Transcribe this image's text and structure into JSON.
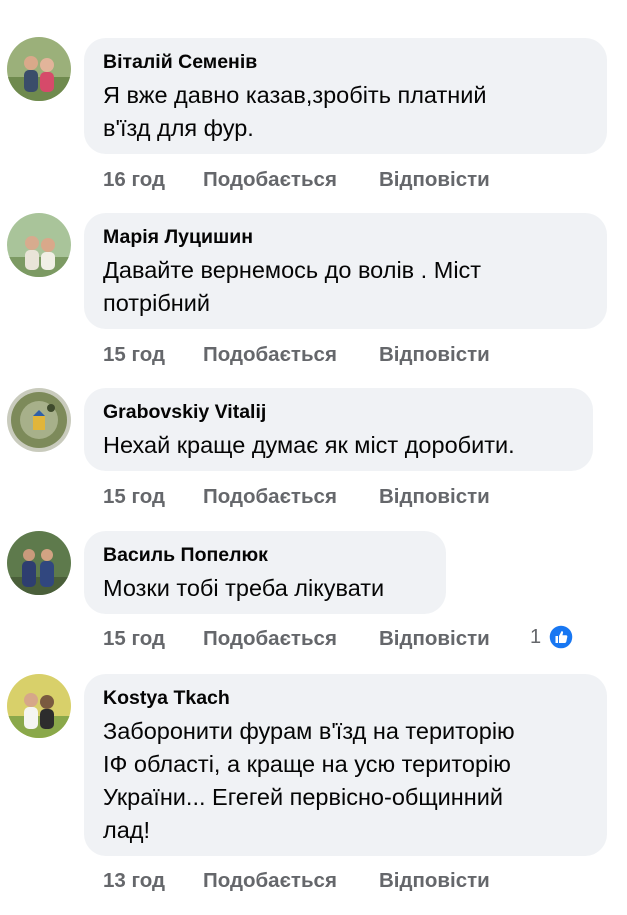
{
  "header_fragment": "",
  "actions": {
    "like": "Подобається",
    "reply": "Відповісти"
  },
  "comments": [
    {
      "author": "Віталій Семенів",
      "text": "Я вже давно казав,зробіть платний\nв'їзд для фур.",
      "time": "16 год"
    },
    {
      "author": "Марія Луцишин",
      "text": "Давайте вернемось до волів . Міст\nпотрібний",
      "time": "15 год"
    },
    {
      "author": "Grabovskiy Vitalij",
      "text": "Нехай краще думає як міст доробити.",
      "time": "15 год"
    },
    {
      "author": "Василь Попелюк",
      "text": "Мозки тобі треба лікувати",
      "time": "15 год",
      "reaction_count": "1",
      "reaction_icon": "thumbs-up-icon",
      "reaction_color": "#1877f2"
    },
    {
      "author": "Kostya Tkach",
      "text": "Заборонити фурам в'їзд на територію\nІФ області, а краще на усю територію\nУкраїни... Егегей первісно-общинний\nлад!",
      "time": "13 год"
    }
  ],
  "colors": {
    "bubble_bg": "#f0f2f5",
    "text": "#050505",
    "meta_text": "#65676b",
    "like_blue": "#1877f2"
  }
}
